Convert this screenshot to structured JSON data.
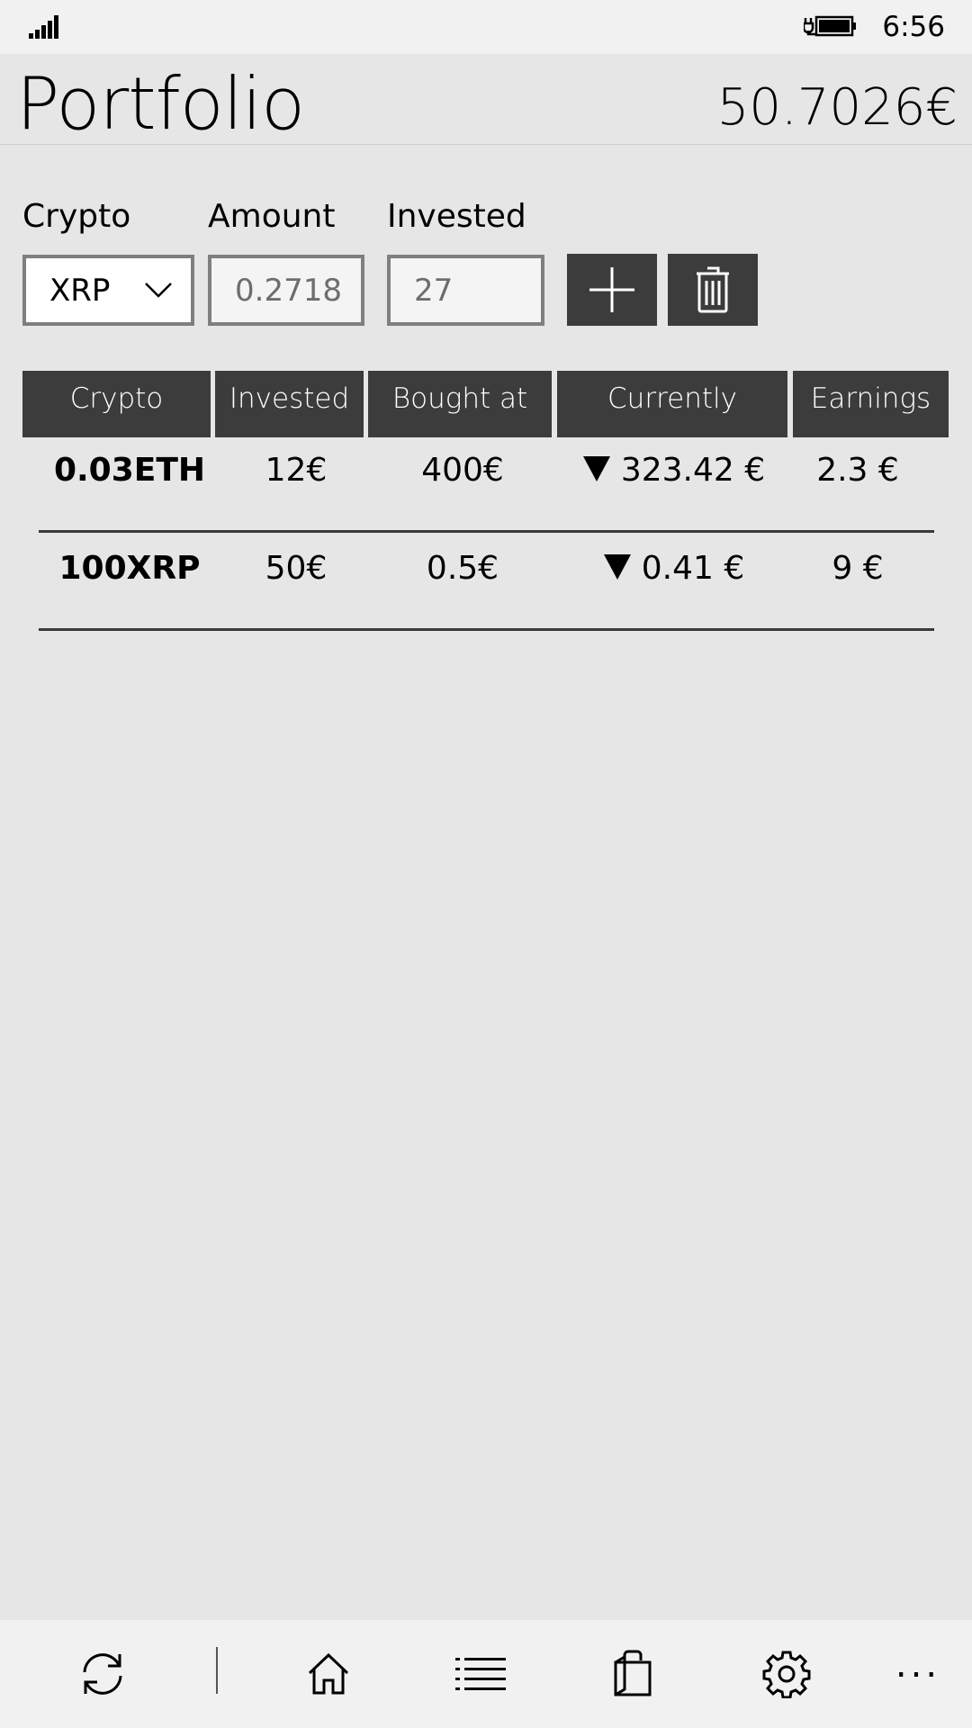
{
  "status_bar": {
    "time": "6:56"
  },
  "header": {
    "title": "Portfolio",
    "total": "50.7026€"
  },
  "form": {
    "crypto_label": "Crypto",
    "amount_label": "Amount",
    "invested_label": "Invested",
    "crypto_selected": "XRP",
    "amount_value": "0.2718",
    "invested_value": "27"
  },
  "table": {
    "headers": [
      "Crypto",
      "Invested",
      "Bought at",
      "Currently",
      "Earnings"
    ],
    "rows": [
      {
        "crypto": "0.03ETH",
        "invested": "12€",
        "bought_at": "400€",
        "currently": "323.42 €",
        "trend": "down",
        "earnings": "2.3 €"
      },
      {
        "crypto": "100XRP",
        "invested": "50€",
        "bought_at": "0.5€",
        "currently": "0.41 €",
        "trend": "down",
        "earnings": "9 €"
      }
    ]
  },
  "app_bar": {
    "more": "..."
  },
  "icons": {
    "signal": "signal-strength-icon",
    "battery": "battery-charging-icon",
    "add": "plus-icon",
    "delete": "trash-icon",
    "refresh": "refresh-icon",
    "home": "home-icon",
    "list": "list-icon",
    "store": "shopping-bag-icon",
    "settings": "gear-icon"
  },
  "colors": {
    "background": "#e6e6e6",
    "header_cell": "#3c3c3c",
    "bar_background": "#f1f1f1"
  }
}
